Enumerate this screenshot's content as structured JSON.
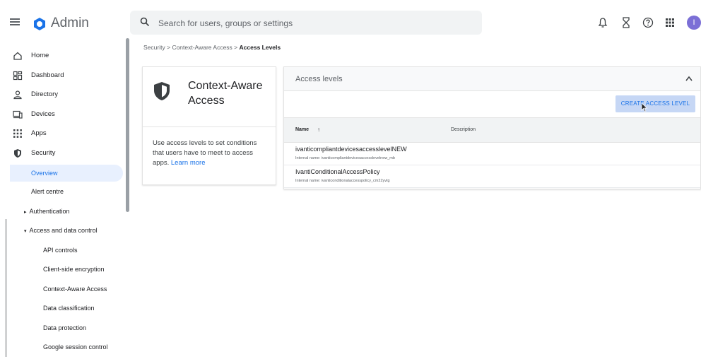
{
  "app": {
    "title": "Admin",
    "avatar_initial": "I",
    "brand_color": "#1a73e8"
  },
  "search": {
    "placeholder": "Search for users, groups or settings"
  },
  "topbar_icons": [
    "bell-icon",
    "hourglass-icon",
    "help-icon",
    "apps-grid-icon"
  ],
  "sidebar": {
    "items": [
      {
        "label": "Home",
        "icon": "home-icon"
      },
      {
        "label": "Dashboard",
        "icon": "dashboard-icon"
      },
      {
        "label": "Directory",
        "icon": "person-icon"
      },
      {
        "label": "Devices",
        "icon": "devices-icon"
      },
      {
        "label": "Apps",
        "icon": "apps-grid-icon"
      },
      {
        "label": "Security",
        "icon": "shield-icon"
      }
    ],
    "security_sub": {
      "overview": "Overview",
      "alert_centre": "Alert centre",
      "authentication": "Authentication",
      "access_and_data_control": "Access and data control"
    },
    "access_sub": [
      "API controls",
      "Client-side encryption",
      "Context-Aware Access",
      "Data classification",
      "Data protection",
      "Google session control"
    ]
  },
  "breadcrumb": {
    "part1": "Security",
    "sep": ">",
    "part2": "Context-Aware Access",
    "current": "Access Levels"
  },
  "caa_card": {
    "title": "Context-Aware Access",
    "description": "Use access levels to set conditions that users have to meet to access apps.",
    "learn_more": "Learn more"
  },
  "access_levels": {
    "title": "Access levels",
    "create_button": "CREATE ACCESS LEVEL",
    "columns": {
      "name": "Name",
      "sort_arrow": "↑",
      "description": "Description"
    },
    "rows": [
      {
        "name": "ivanticompliantdevicesaccesslevelNEW",
        "internal": "Internal name: ivanticompliantdevicesaccesslevelnew_mb"
      },
      {
        "name": "IvantiConditionalAccessPolicy",
        "internal": "Internal name: ivanticonditionalaccesspolicy_cm22yvtg"
      }
    ]
  }
}
